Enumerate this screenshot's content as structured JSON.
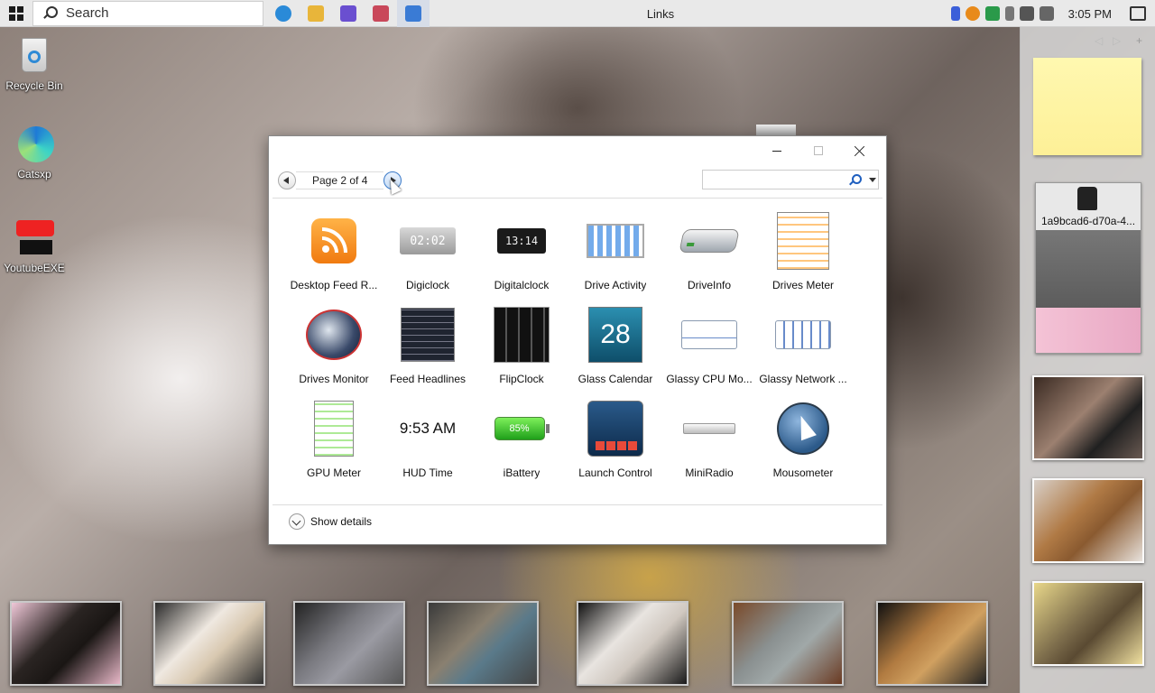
{
  "taskbar": {
    "search_placeholder": "Search",
    "window_title": "Links",
    "clock": "3:05 PM",
    "pinned_apps": [
      {
        "name": "edge-icon",
        "color": "#2a8ad8"
      },
      {
        "name": "file-explorer-icon",
        "color": "#e8b53a"
      },
      {
        "name": "app-purple-icon",
        "color": "#6a4fd0"
      },
      {
        "name": "app-flag-icon",
        "color": "#c9485a"
      },
      {
        "name": "app-window-icon",
        "color": "#3a7bd5"
      }
    ]
  },
  "desktop": {
    "icons": [
      {
        "label": "Recycle Bin"
      },
      {
        "label": "Catsxp"
      },
      {
        "label": "YoutubeEXE"
      }
    ]
  },
  "sidebar": {
    "slideshow_caption": "1a9bcad6-d70a-4..."
  },
  "dialog": {
    "page_label": "Page 2 of 4",
    "search_value": "",
    "show_details": "Show details",
    "gadgets": [
      {
        "label": "Desktop Feed R..."
      },
      {
        "label": "Digiclock",
        "display": "02:02"
      },
      {
        "label": "Digitalclock",
        "display": "13:14"
      },
      {
        "label": "Drive Activity"
      },
      {
        "label": "DriveInfo"
      },
      {
        "label": "Drives Meter"
      },
      {
        "label": "Drives Monitor"
      },
      {
        "label": "Feed Headlines"
      },
      {
        "label": "FlipClock"
      },
      {
        "label": "Glass Calendar",
        "display": "28"
      },
      {
        "label": "Glassy CPU Mo..."
      },
      {
        "label": "Glassy Network ..."
      },
      {
        "label": "GPU Meter"
      },
      {
        "label": "HUD Time",
        "display": "9:53 AM"
      },
      {
        "label": "iBattery",
        "display": "85%"
      },
      {
        "label": "Launch Control"
      },
      {
        "label": "MiniRadio"
      },
      {
        "label": "Mousometer"
      }
    ]
  },
  "colors": {
    "taskbar_bg": "#e9e9e9",
    "accent": "#3b7ac8",
    "sticky_note": "#fdf097"
  }
}
